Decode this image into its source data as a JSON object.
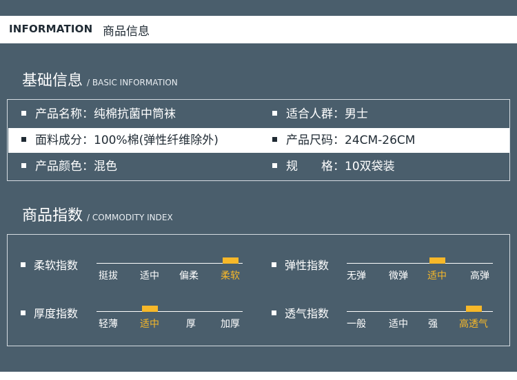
{
  "header": {
    "en": "INFORMATION",
    "cn": "商品信息"
  },
  "basic": {
    "title": "基础信息",
    "subtitle": "/ BASIC INFORMATION",
    "rows": [
      {
        "left": "产品名称：纯棉抗菌中筒袜",
        "right": "适合人群：男士"
      },
      {
        "left": "面料成分：100%棉(弹性纤维除外)",
        "right": "产品尺码：24CM-26CM"
      },
      {
        "left": "产品颜色：混色",
        "right": "规　　格：10双袋装"
      }
    ]
  },
  "commodity": {
    "title": "商品指数",
    "subtitle": "/ COMMODITY INDEX",
    "indices": [
      {
        "label": "柔软指数",
        "options": [
          "挺拔",
          "适中",
          "偏柔",
          "柔软"
        ],
        "selected": 3
      },
      {
        "label": "弹性指数",
        "options": [
          "无弹",
          "微弹",
          "适中",
          "高弹"
        ],
        "selected": 2
      },
      {
        "label": "厚度指数",
        "options": [
          "轻薄",
          "适中",
          "厚",
          "加厚"
        ],
        "selected": 1
      },
      {
        "label": "透气指数",
        "options": [
          "一般",
          "适中",
          "强",
          "高透气"
        ],
        "selected": 3
      }
    ]
  },
  "colors": {
    "panel": "#4a5e6c",
    "accent": "#f7b829",
    "text_light": "#ffffff",
    "text_dark": "#1f2a33"
  }
}
